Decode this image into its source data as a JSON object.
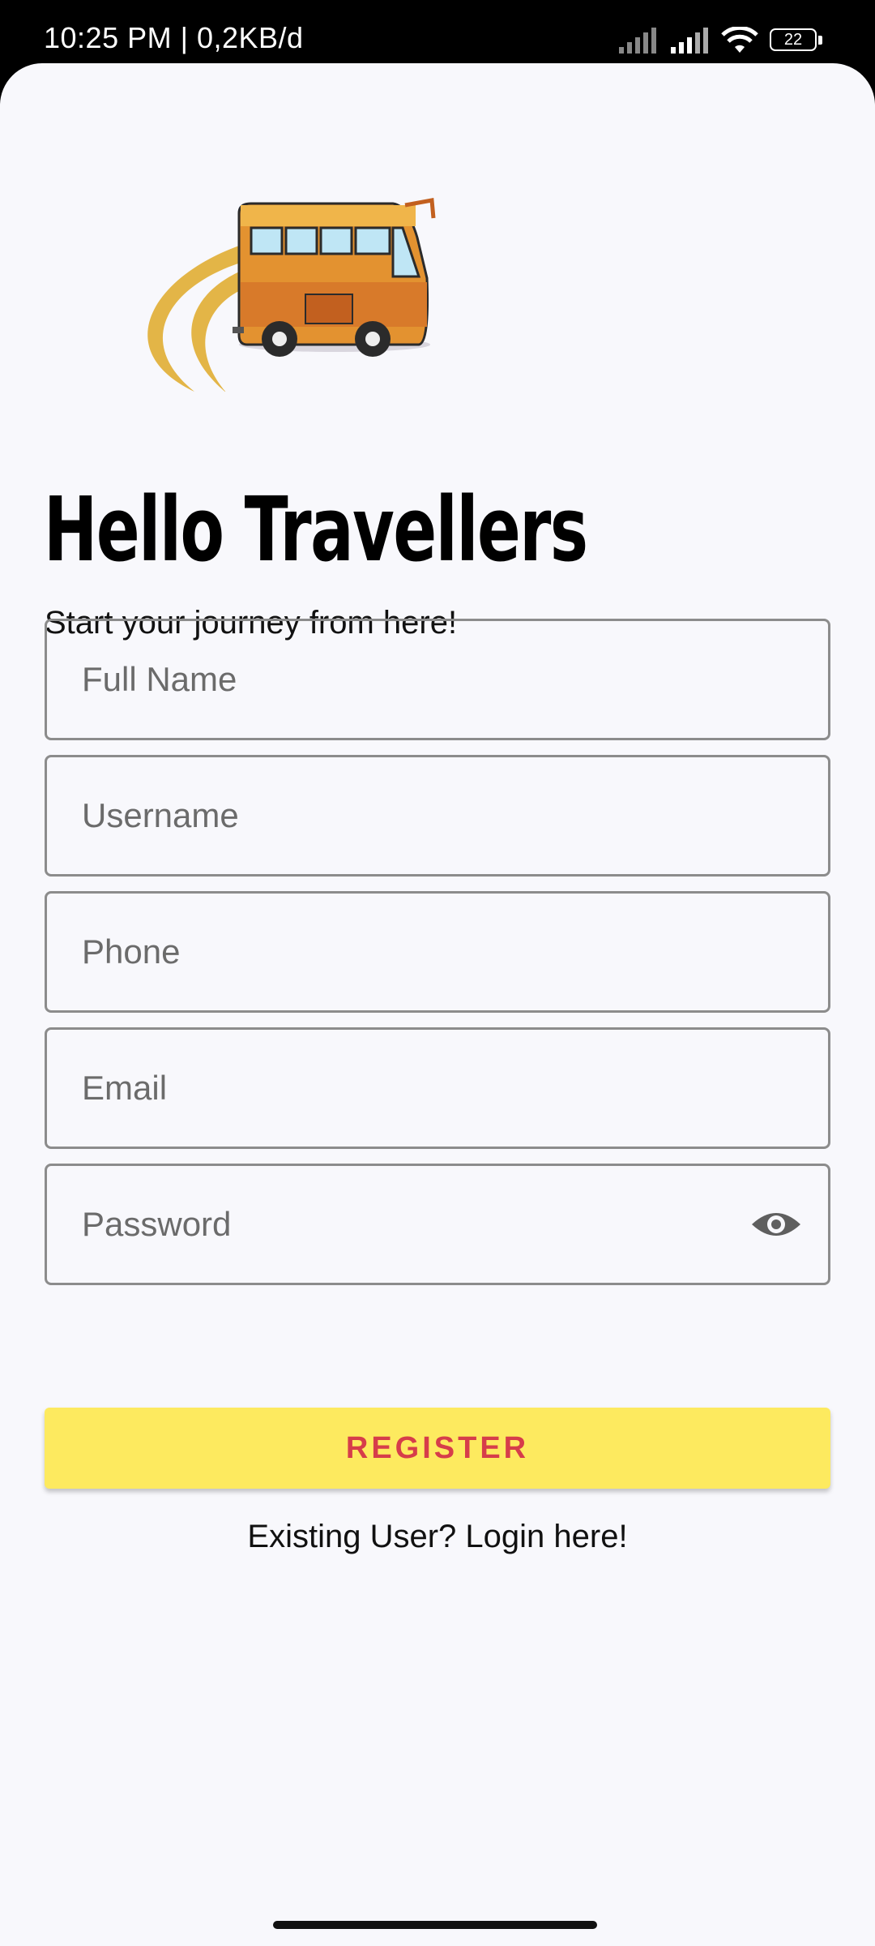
{
  "status_bar": {
    "time": "10:25 PM | 0,2KB/d",
    "battery": "22"
  },
  "header": {
    "title": "Hello Travellers",
    "subtitle": "Start your journey from here!"
  },
  "form": {
    "full_name_placeholder": "Full Name",
    "username_placeholder": "Username",
    "phone_placeholder": "Phone",
    "email_placeholder": "Email",
    "password_placeholder": "Password"
  },
  "actions": {
    "register_label": "REGISTER",
    "login_link": "Existing User? Login here!"
  },
  "colors": {
    "background": "#f8f8fc",
    "register_button": "#fdea5f",
    "register_text": "#d63d4a",
    "field_border": "#8c8c8c"
  },
  "icons": [
    "signal-icon",
    "wifi-icon",
    "battery-icon",
    "bus-logo",
    "eye-icon"
  ]
}
